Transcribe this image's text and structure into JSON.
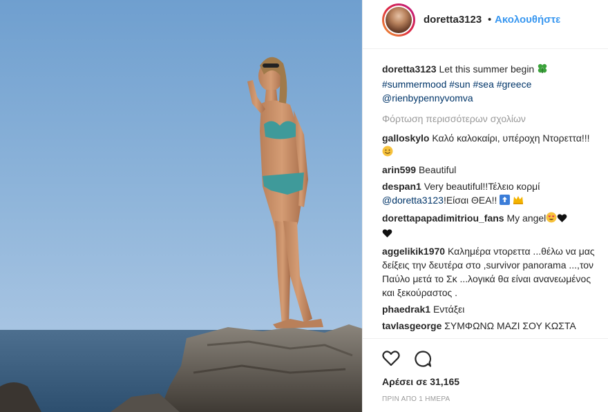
{
  "post": {
    "username": "doretta3123",
    "separator": "•",
    "follow_label": "Ακολουθήστε",
    "caption": {
      "user": "doretta3123",
      "text": "Let this summer begin",
      "emoji": "four-leaf-clover",
      "hashtags": [
        "#summermood",
        "#sun",
        "#sea",
        "#greece"
      ],
      "mention": "@rienbypennyvomva"
    },
    "load_more": "Φόρτωση περισσότερων σχολίων",
    "comments": [
      {
        "user": "galloskylo",
        "text": "Καλό καλοκαίρι, υπέροχη Ντορεττα!!!"
      },
      {
        "user": "arin599",
        "text": "Beautiful"
      },
      {
        "user": "despan1",
        "text": "Very beautiful!!Τέλειο κορμί",
        "mention": "@doretta3123",
        "text2": "!Είσαι ΘΕΑ!!"
      },
      {
        "user": "dorettapapadimitriou_fans",
        "text": "My angel"
      },
      {
        "user": "aggelikik1970",
        "text": "Καλημέρα ντορεττα ...θέλω να μας δείξεις την δευτέρα στο ,survivor panorama ...,τον Παύλο μετά το Σκ ...λογικά θα είναι ανανεωμένος και ξεκούραστος ."
      },
      {
        "user": "phaedrak1",
        "text": "Εντάξει"
      },
      {
        "user": "tavlasgeorge",
        "text": "ΣΥΜΦΩΝΩ ΜΑΖΙ ΣΟΥ ΚΩΣΤΑ"
      }
    ],
    "likes": "Αρέσει σε 31,165",
    "timestamp": "ΠΡΙΝ ΑΠΟ 1 ΗΜΕΡΑ",
    "icons": {
      "like": "heart-outline-icon",
      "comment": "comment-bubble-icon"
    },
    "colors": {
      "link": "#3897f0",
      "tag": "#003569",
      "muted": "#999999",
      "text": "#262626"
    }
  }
}
